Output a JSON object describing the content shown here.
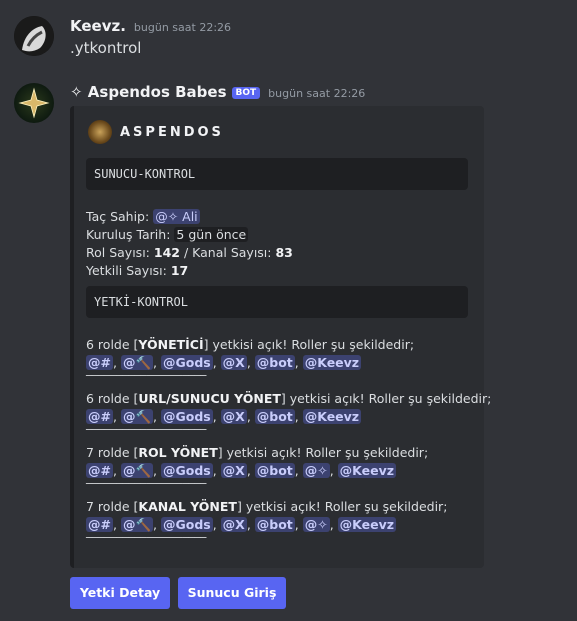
{
  "messages": [
    {
      "username": "Keevz.",
      "timestamp": "bugün saat 22:26",
      "content": ".ytkontrol"
    },
    {
      "username": "✧ Aspendos Babes",
      "bot_badge": "BOT",
      "timestamp": "bugün saat 22:26"
    }
  ],
  "embed": {
    "author": "ASPENDOS",
    "code1": "SUNUCU-KONTROL",
    "owner_label": "Taç Sahip:",
    "owner_value": "@✧ Ali",
    "created_label": "Kuruluş Tarih:",
    "created_value": "5 gün önce",
    "roles_label": "Rol Sayısı:",
    "roles_value": "142",
    "sep_slash": "/",
    "channels_label": "Kanal Sayısı:",
    "channels_value": "83",
    "staff_label": "Yetkili Sayısı:",
    "staff_value": "17",
    "code2": "YETKİ-KONTROL",
    "divider": "────────────────────",
    "perm_blocks": [
      {
        "prefix": "6 rolde [",
        "perm": "YÖNETİCİ",
        "suffix": "] yetkisi açık! Roller şu şekildedir;",
        "roles": [
          "@#",
          "@🔨",
          "@Gods",
          "@X",
          "@bot",
          "@Keevz"
        ]
      },
      {
        "prefix": "6 rolde [",
        "perm": "URL/SUNUCU YÖNET",
        "suffix": "] yetkisi açık! Roller şu şekildedir;",
        "roles": [
          "@#",
          "@🔨",
          "@Gods",
          "@X",
          "@bot",
          "@Keevz"
        ]
      },
      {
        "prefix": "7 rolde [",
        "perm": "ROL YÖNET",
        "suffix": "] yetkisi açık! Roller şu şekildedir;",
        "roles": [
          "@#",
          "@🔨",
          "@Gods",
          "@X",
          "@bot",
          "@✧",
          "@Keevz"
        ]
      },
      {
        "prefix": "7 rolde [",
        "perm": "KANAL YÖNET",
        "suffix": "] yetkisi açık! Roller şu şekildedir;",
        "roles": [
          "@#",
          "@🔨",
          "@Gods",
          "@X",
          "@bot",
          "@✧",
          "@Keevz"
        ]
      }
    ]
  },
  "buttons": [
    "Yetki Detay",
    "Sunucu Giriş"
  ]
}
